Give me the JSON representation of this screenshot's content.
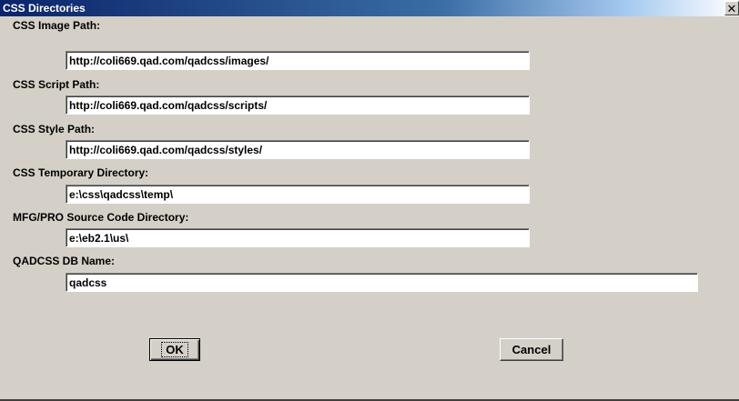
{
  "window": {
    "title": "CSS Directories",
    "close_glyph": "✕"
  },
  "fields": [
    {
      "label": "CSS Image Path:",
      "value": "http://coli669.qad.com/qadcss/images/"
    },
    {
      "label": "CSS Script Path:",
      "value": "http://coli669.qad.com/qadcss/scripts/"
    },
    {
      "label": "CSS Style Path:",
      "value": "http://coli669.qad.com/qadcss/styles/"
    },
    {
      "label": "CSS Temporary Directory:",
      "value": "e:\\css\\qadcss\\temp\\"
    },
    {
      "label": "MFG/PRO Source Code Directory:",
      "value": "e:\\eb2.1\\us\\"
    },
    {
      "label": "QADCSS DB Name:",
      "value": "qadcss"
    }
  ],
  "buttons": {
    "ok_label": "OK",
    "cancel_label": "Cancel"
  },
  "colors": {
    "title_bar": "#0a246a",
    "dialog_face": "#d4d0c8"
  }
}
